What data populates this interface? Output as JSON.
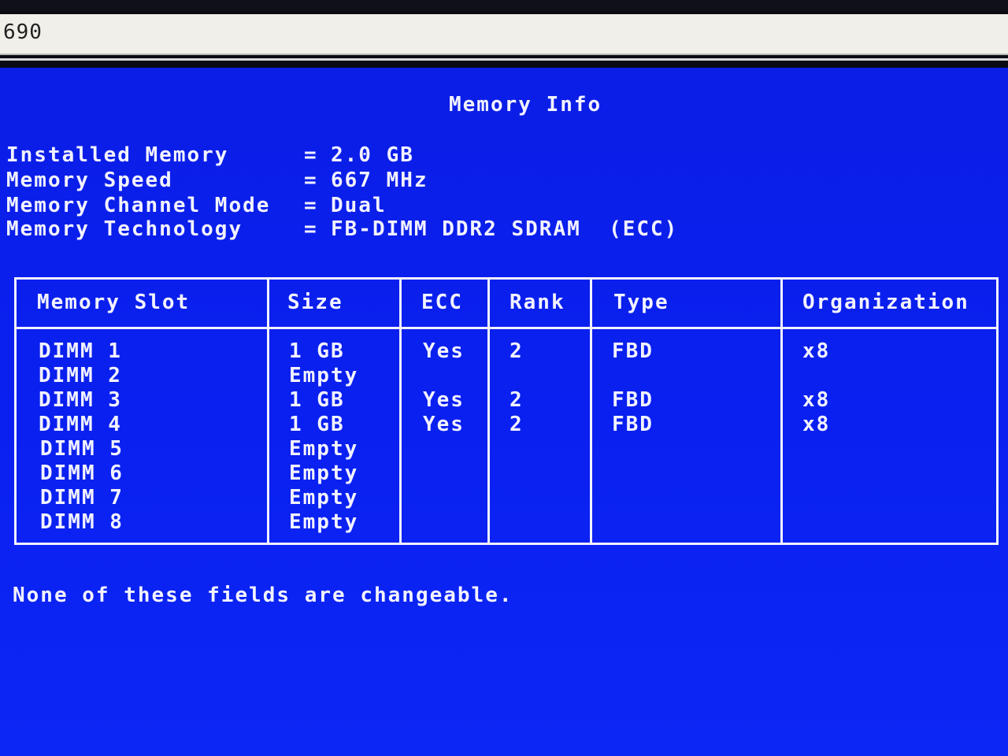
{
  "label_strip": {
    "text": "690"
  },
  "screen": {
    "title": "Memory Info",
    "info": [
      {
        "label": "Installed Memory",
        "value": "2.0 GB"
      },
      {
        "label": "Memory Speed",
        "value": "667 MHz"
      },
      {
        "label": "Memory Channel Mode",
        "value": "Dual"
      },
      {
        "label": "Memory Technology",
        "value": "FB-DIMM DDR2 SDRAM  (ECC)"
      }
    ],
    "eq": "=",
    "table": {
      "headers": [
        "Memory Slot",
        "Size",
        "ECC",
        "Rank",
        "Type",
        "Organization"
      ],
      "rows": [
        [
          "DIMM 1",
          "1 GB",
          "Yes",
          "2",
          "FBD",
          "x8"
        ],
        [
          "DIMM 2",
          "Empty",
          "",
          "",
          "",
          ""
        ],
        [
          "DIMM 3",
          "1 GB",
          "Yes",
          "2",
          "FBD",
          "x8"
        ],
        [
          "DIMM 4",
          "1 GB",
          "Yes",
          "2",
          "FBD",
          "x8"
        ],
        [
          "DIMM 5",
          "Empty",
          "",
          "",
          "",
          ""
        ],
        [
          "DIMM 6",
          "Empty",
          "",
          "",
          "",
          ""
        ],
        [
          "DIMM 7",
          "Empty",
          "",
          "",
          "",
          ""
        ],
        [
          "DIMM 8",
          "Empty",
          "",
          "",
          "",
          ""
        ]
      ]
    },
    "footer": "None of these fields are changeable."
  }
}
